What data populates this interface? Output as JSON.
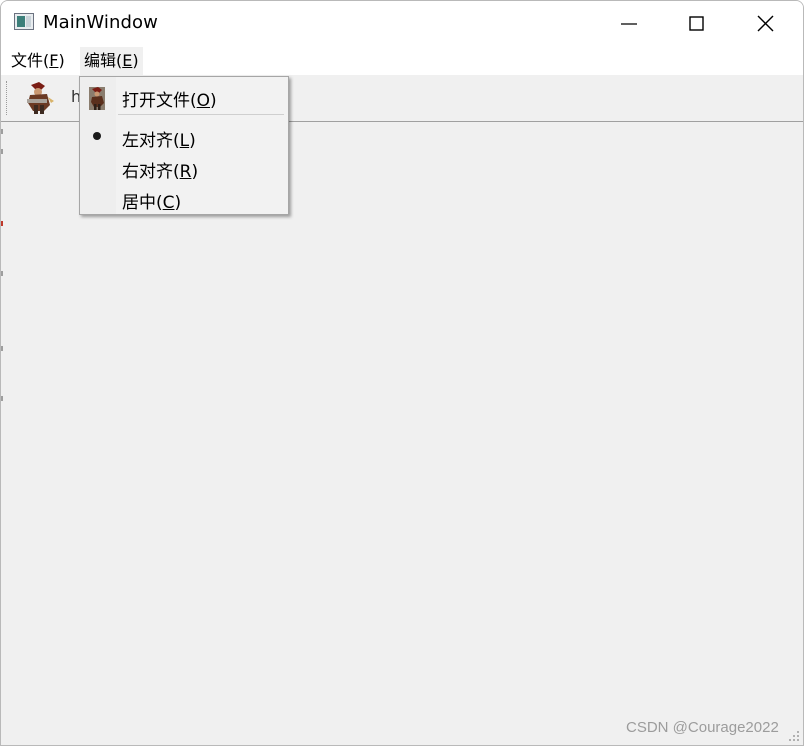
{
  "window": {
    "title": "MainWindow"
  },
  "menubar": {
    "items": [
      {
        "label": "文件(",
        "mnemonic": "F",
        "suffix": ")"
      },
      {
        "label": "编辑(",
        "mnemonic": "E",
        "suffix": ")"
      }
    ]
  },
  "toolbar": {
    "action_icon": "character-picture-icon",
    "text": "h"
  },
  "edit_menu": {
    "items": [
      {
        "label": "打开文件(",
        "mnemonic": "O",
        "suffix": ")",
        "icon": "character-picture-icon"
      },
      {
        "label": "左对齐(",
        "mnemonic": "L",
        "suffix": ")",
        "checked": true
      },
      {
        "label": "右对齐(",
        "mnemonic": "R",
        "suffix": ")",
        "checked": false
      },
      {
        "label": "居中(",
        "mnemonic": "C",
        "suffix": ")",
        "checked": false
      }
    ]
  },
  "watermark": "CSDN @Courage2022",
  "colors": {
    "window_bg": "#f0f0f0",
    "titlebar_bg": "#ffffff",
    "menu_bg": "#f2f2f2"
  }
}
